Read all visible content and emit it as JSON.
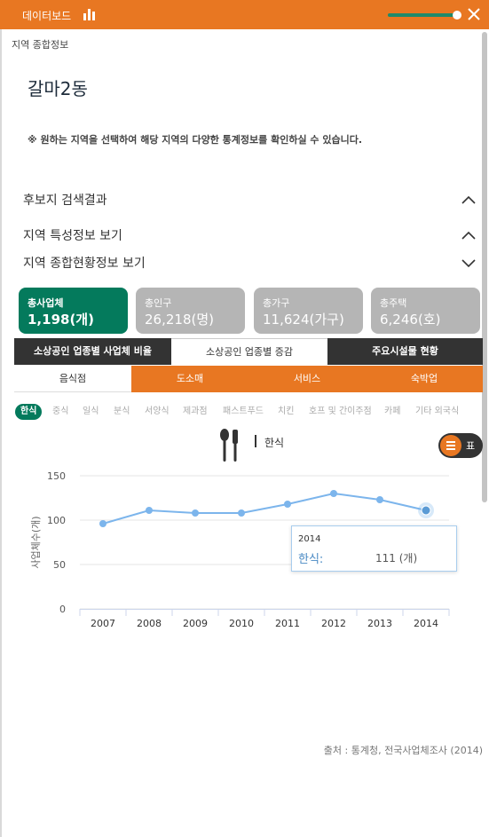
{
  "header": {
    "title": "데이터보드"
  },
  "breadcrumb": "지역 종합정보",
  "region": "갈마2동",
  "notice": "※ 원하는 지역을 선택하여 해당 지역의 다양한 통계정보를 확인하실 수 있습니다.",
  "accordion": [
    {
      "label": "후보지 검색결과",
      "state": "expanded"
    },
    {
      "label": "지역 특성정보 보기",
      "state": "expanded"
    },
    {
      "label": "지역 종합현황정보 보기",
      "state": "collapsed"
    }
  ],
  "stats": [
    {
      "label": "총사업체",
      "value": "1,198(개)"
    },
    {
      "label": "총인구",
      "value": "26,218(명)"
    },
    {
      "label": "총가구",
      "value": "11,624(가구)"
    },
    {
      "label": "총주택",
      "value": "6,246(호)"
    }
  ],
  "tabs": [
    "소상공인 업종별 사업체 비율",
    "소상공인 업종별 증감",
    "주요시설물 현황"
  ],
  "subtabs": [
    "음식점",
    "도소매",
    "서비스",
    "숙박업"
  ],
  "chips": [
    "한식",
    "중식",
    "일식",
    "분식",
    "서양식",
    "제과점",
    "패스트푸드",
    "치킨",
    "호프 및 간이주점",
    "카페",
    "기타 외국식"
  ],
  "category_title": "한식",
  "toggle_label": "표",
  "tooltip": {
    "year": "2014",
    "name": "한식:",
    "value": "111 (개)"
  },
  "source": "출처 : 통계청, 전국사업체조사 (2014)",
  "colors": {
    "brand": "#e87722",
    "active": "#047a5c",
    "line": "#7cb5ec"
  },
  "chart_data": {
    "type": "line",
    "categories": [
      "2007",
      "2008",
      "2009",
      "2010",
      "2011",
      "2012",
      "2013",
      "2014"
    ],
    "series": [
      {
        "name": "한식",
        "values": [
          96,
          111,
          108,
          108,
          118,
          130,
          123,
          111
        ]
      }
    ],
    "ylabel": "사업체수(개)",
    "yticks": [
      0,
      50,
      100,
      150
    ],
    "ylim": [
      0,
      150
    ],
    "grid": true,
    "highlight_index": 7
  }
}
